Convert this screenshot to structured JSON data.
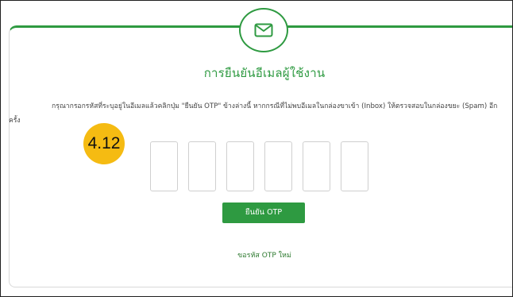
{
  "page": {
    "title": "การยืนยันอีเมลผู้ใช้งาน",
    "instructions": "กรุณากรอกรหัสที่ระบุอยู่ในอีเมลแล้วคลิกปุ่ม \"ยืนยัน OTP\" ข้างล่างนี้ หากกรณีที่ไม่พบอีเมลในกล่องขาเข้า (Inbox) ให้ตรวจสอบในกล่องขยะ (Spam) อีกครั้ง",
    "icon": "envelope-icon"
  },
  "otp": {
    "digits": [
      "",
      "",
      "",
      "",
      "",
      ""
    ]
  },
  "actions": {
    "confirm_label": "ยืนยัน OTP",
    "resend_label": "ขอรหัส OTP ใหม่"
  },
  "annotation": {
    "badge_label": "4.12"
  },
  "colors": {
    "accent": "#2e9a41",
    "badge": "#f5bb12"
  }
}
